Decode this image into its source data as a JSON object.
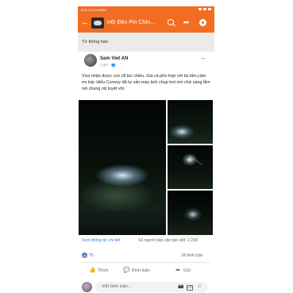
{
  "status_bar": {
    "time": "3:30 CH | 0,5KB/s"
  },
  "header": {
    "back_glyph": "←",
    "group_title": "Hội Đèn Pin Chín...",
    "search_icon": "search-icon",
    "share_icon": "share-icon",
    "settings_icon": "settings-icon",
    "share_glyph": "➦",
    "accent_color": "#f26d22"
  },
  "section": {
    "label": "Từ thông báo"
  },
  "post": {
    "author": "Sam Viet AN",
    "time": "1 giờ · 👥",
    "more_glyph": "···",
    "text": "Vừa nhận được con c8 lúc chiều. Giá cả phù hợp với túi tiền,cảm ơn bác Hiếu Convoy đã tư vấn.máy ảnh chụp hơi mờ chứ sáng lắm nói chung rất tuyệt vời.",
    "translation_link": "Xem thông tin chi tiết",
    "views": "Số người tiếp cận bài viết: 2.234",
    "like_count": "75",
    "like_badge_glyph": "👍",
    "comment_count": "18 bình luận"
  },
  "actions": {
    "like": {
      "label": "Thích",
      "glyph": "👍"
    },
    "comment": {
      "label": "Bình luận",
      "glyph": "💬"
    },
    "share": {
      "label": "Gửi",
      "glyph": "➦"
    }
  },
  "composer": {
    "placeholder": "Viết bình luận...",
    "camera_glyph": "📷",
    "gif_label": "GIF",
    "emoji_glyph": "☺"
  }
}
